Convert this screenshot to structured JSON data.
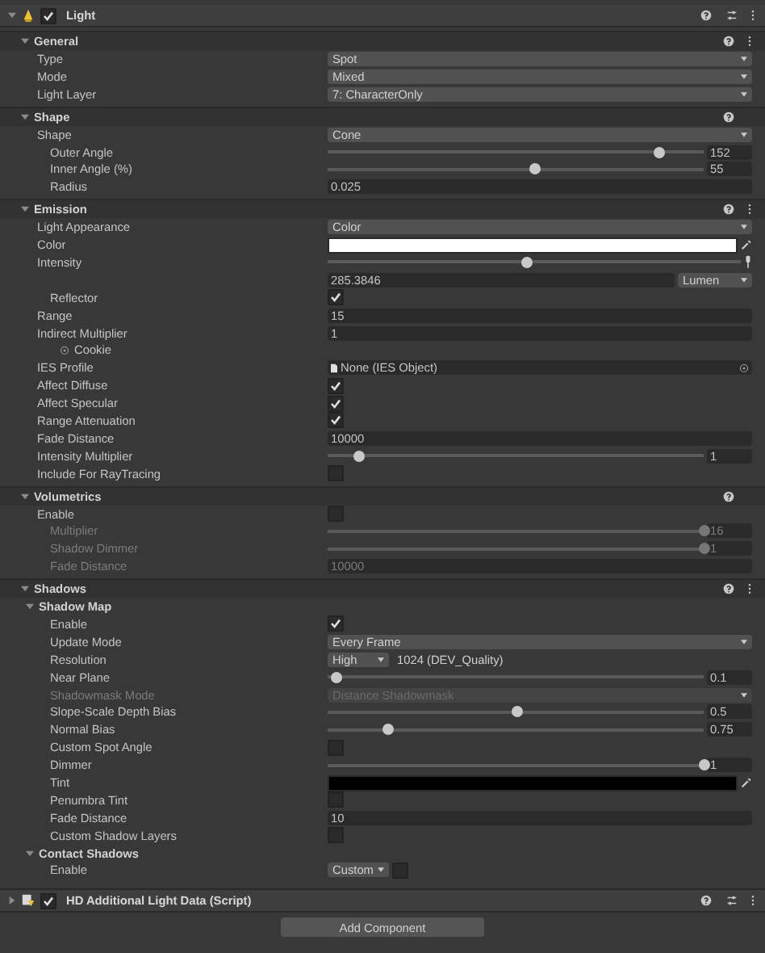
{
  "component": {
    "title": "Light",
    "enabled": true,
    "expanded": true
  },
  "sections": [
    {
      "title": "General",
      "expanded": true,
      "menu": true,
      "rows": [
        {
          "label": "Type",
          "kind": "dropdown",
          "value": "Spot"
        },
        {
          "label": "Mode",
          "kind": "dropdown",
          "value": "Mixed"
        },
        {
          "label": "Light Layer",
          "kind": "dropdown",
          "value": "7: CharacterOnly"
        }
      ]
    },
    {
      "title": "Shape",
      "expanded": true,
      "menu": false,
      "rows": [
        {
          "label": "Shape",
          "kind": "dropdown",
          "value": "Cone",
          "children": [
            {
              "label": "Outer Angle",
              "kind": "slider",
              "level": 0.88,
              "value": "152"
            },
            {
              "label": "Inner Angle (%)",
              "kind": "slider",
              "level": 0.55,
              "value": "55"
            },
            {
              "label": "Radius",
              "kind": "number",
              "value": "0.025"
            }
          ]
        }
      ]
    },
    {
      "title": "Emission",
      "expanded": true,
      "menu": true,
      "rows": [
        {
          "label": "Light Appearance",
          "kind": "dropdown",
          "value": "Color"
        },
        {
          "label": "Color",
          "kind": "color",
          "color": "#ffffff"
        },
        {
          "label": "Intensity",
          "kind": "wide-slider",
          "level": 0.48,
          "children": [
            {
              "kind": "unit-number",
              "value": "285.3846",
              "unit": "Lumen"
            },
            {
              "label": "Reflector",
              "kind": "checkbox",
              "checked": true
            }
          ]
        },
        {
          "label": "Range",
          "kind": "number",
          "value": "15"
        },
        {
          "label": "Indirect Multiplier",
          "kind": "number",
          "value": "1",
          "children": [
            {
              "label": "Cookie",
              "kind": "label"
            }
          ]
        },
        {
          "label": "IES Profile",
          "kind": "object",
          "value": "None (IES Object)"
        },
        {
          "label": "Affect Diffuse",
          "kind": "checkbox",
          "checked": true
        },
        {
          "label": "Affect Specular",
          "kind": "checkbox",
          "checked": true
        },
        {
          "label": "Range Attenuation",
          "kind": "checkbox",
          "checked": true
        },
        {
          "label": "Fade Distance",
          "kind": "number",
          "value": "10000"
        },
        {
          "label": "Intensity Multiplier",
          "kind": "slider",
          "level": 0.08,
          "value": "1"
        },
        {
          "label": "Include For RayTracing",
          "kind": "checkbox",
          "checked": false
        }
      ]
    },
    {
      "title": "Volumetrics",
      "expanded": true,
      "menu": false,
      "rows": [
        {
          "label": "Enable",
          "kind": "checkbox",
          "checked": false,
          "children": [
            {
              "label": "Multiplier",
              "kind": "slider",
              "level": 1,
              "value": "16",
              "disabled": true
            },
            {
              "label": "Shadow Dimmer",
              "kind": "slider",
              "level": 1,
              "value": "1",
              "disabled": true
            },
            {
              "label": "Fade Distance",
              "kind": "number",
              "value": "10000",
              "disabled": true
            }
          ]
        }
      ]
    },
    {
      "title": "Shadows",
      "expanded": true,
      "menu": true,
      "rows": [
        {
          "label": "Shadow Map",
          "kind": "group",
          "expanded": true,
          "children": [
            {
              "label": "Enable",
              "kind": "checkbox",
              "checked": true
            },
            {
              "label": "Update Mode",
              "kind": "dropdown",
              "value": "Every Frame"
            },
            {
              "label": "Resolution",
              "kind": "tier",
              "tier": "High",
              "value": "1024 (DEV_Quality)"
            },
            {
              "label": "Near Plane",
              "kind": "slider",
              "level": 0.02,
              "value": "0.1"
            },
            {
              "label": "Shadowmask Mode",
              "kind": "dropdown",
              "value": "Distance Shadowmask",
              "disabled": true
            },
            {
              "label": "Slope-Scale Depth Bias",
              "kind": "slider",
              "level": 0.5,
              "value": "0.5"
            },
            {
              "label": "Normal Bias",
              "kind": "slider",
              "level": 0.16,
              "value": "0.75"
            },
            {
              "label": "Custom Spot Angle",
              "kind": "checkbox",
              "checked": false
            },
            {
              "label": "Dimmer",
              "kind": "slider",
              "level": 1,
              "value": "1"
            },
            {
              "label": "Tint",
              "kind": "color",
              "color": "#000000"
            },
            {
              "label": "Penumbra Tint",
              "kind": "checkbox",
              "checked": false
            },
            {
              "label": "Fade Distance",
              "kind": "number",
              "value": "10"
            },
            {
              "label": "Custom Shadow Layers",
              "kind": "checkbox",
              "checked": false
            }
          ]
        },
        {
          "label": "Contact Shadows",
          "kind": "group",
          "expanded": true,
          "children": [
            {
              "label": "Enable",
              "kind": "mode-toggle",
              "value": "Custom",
              "checked": false
            }
          ]
        }
      ]
    }
  ],
  "script_component": {
    "title": "HD Additional Light Data (Script)",
    "enabled": true,
    "expanded": false
  },
  "add_button": "Add Component"
}
